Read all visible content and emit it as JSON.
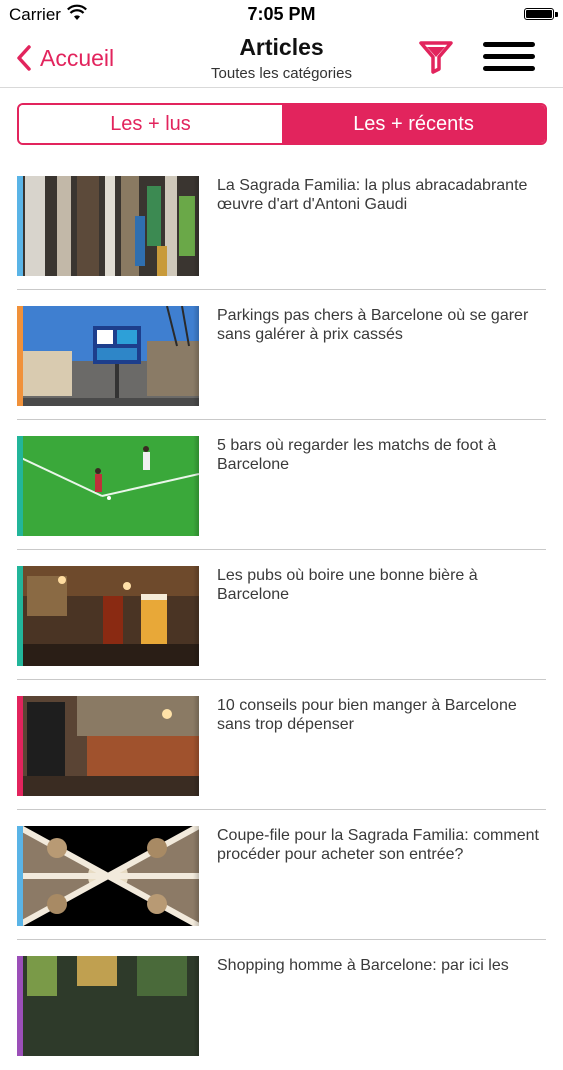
{
  "status_bar": {
    "carrier": "Carrier",
    "time": "7:05 PM"
  },
  "nav": {
    "back_label": "Accueil",
    "title": "Articles",
    "subtitle": "Toutes les catégories",
    "accent_color": "#e2245d"
  },
  "segment": {
    "options": [
      {
        "label": "Les + lus",
        "selected": false
      },
      {
        "label": "Les + récents",
        "selected": true
      }
    ]
  },
  "articles": [
    {
      "title": "La Sagrada Familia: la plus abracadabrante œuvre d'art d'Antoni Gaudi",
      "category_color": "#5ab4e6",
      "image": "sagrada-interior"
    },
    {
      "title": "Parkings pas chers à Barcelone où se garer sans galérer à prix cassés",
      "category_color": "#f0913a",
      "image": "parking-street"
    },
    {
      "title": "5 bars où regarder les matchs de foot à Barcelone",
      "category_color": "#22b59a",
      "image": "football-pitch"
    },
    {
      "title": "Les pubs où boire une bonne bière à Barcelone",
      "category_color": "#22b59a",
      "image": "beer-pub"
    },
    {
      "title": "10 conseils pour bien manger à Barcelone sans trop dépenser",
      "category_color": "#e2245d",
      "image": "restaurant-bar"
    },
    {
      "title": "Coupe-file pour la Sagrada Familia: comment procéder pour acheter son entrée?",
      "category_color": "#5ab4e6",
      "image": "sagrada-ceiling"
    },
    {
      "title": "Shopping homme à Barcelone: par ici les",
      "category_color": "#9b4fb8",
      "image": "shop-interior"
    }
  ]
}
